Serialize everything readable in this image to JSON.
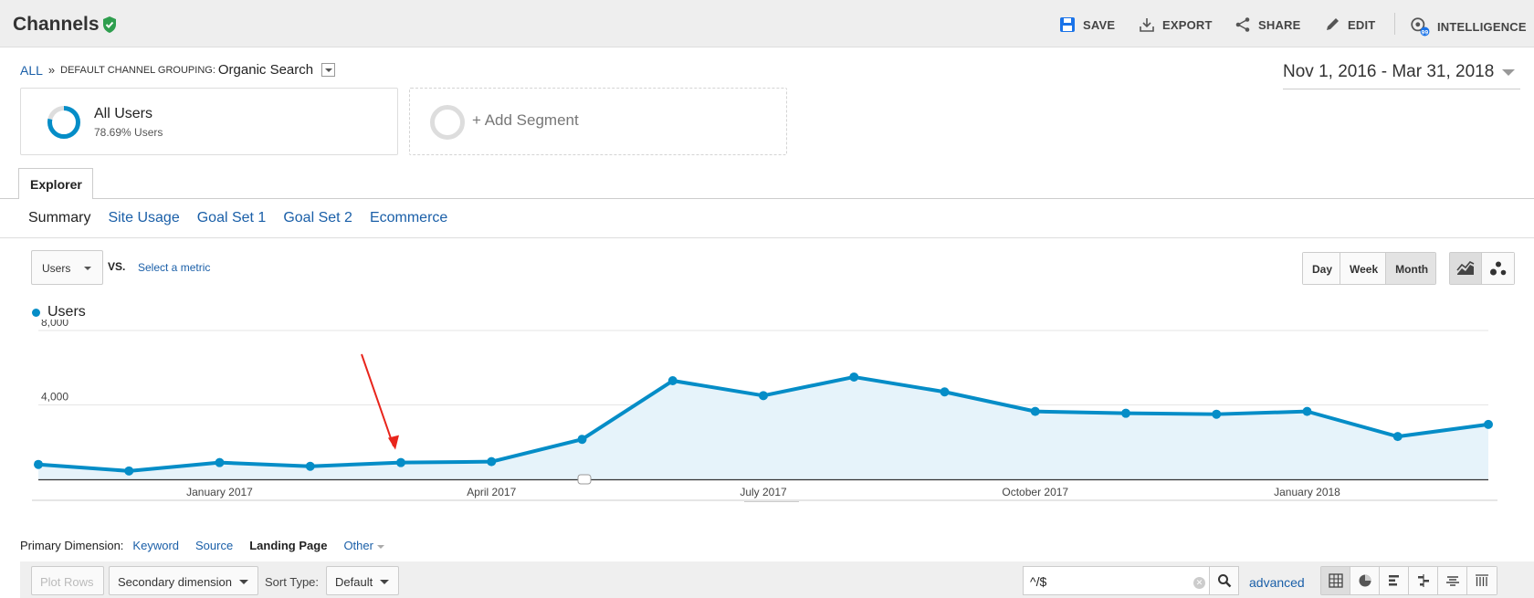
{
  "header": {
    "title": "Channels",
    "actions": {
      "save": "SAVE",
      "export": "EXPORT",
      "share": "SHARE",
      "edit": "EDIT",
      "intelligence": "INTELLIGENCE"
    }
  },
  "breadcrumb": {
    "all": "ALL",
    "sep": "»",
    "grouping_label": "DEFAULT CHANNEL GROUPING:",
    "grouping_value": "Organic Search"
  },
  "date_range": "Nov 1, 2016 - Mar 31, 2018",
  "segments": {
    "active": {
      "name": "All Users",
      "detail": "78.69% Users"
    },
    "add": "+ Add Segment"
  },
  "tabs": {
    "explorer": "Explorer"
  },
  "subtabs": [
    "Summary",
    "Site Usage",
    "Goal Set 1",
    "Goal Set 2",
    "Ecommerce"
  ],
  "controls": {
    "metric": "Users",
    "vs": "VS.",
    "select_metric": "Select a metric",
    "granularity": [
      "Day",
      "Week",
      "Month"
    ],
    "granularity_selected": "Month"
  },
  "primary_dimension": {
    "label": "Primary Dimension:",
    "options": [
      "Keyword",
      "Source",
      "Landing Page",
      "Other"
    ],
    "selected": "Landing Page"
  },
  "table_controls": {
    "plot_rows": "Plot Rows",
    "secondary_dimension": "Secondary dimension",
    "sort_type_label": "Sort Type:",
    "sort_type_value": "Default",
    "filter_value": "^/$",
    "advanced": "advanced"
  },
  "colors": {
    "series": "#058dc7",
    "area_fill": "#e6f3fa",
    "link": "#1a5fa8",
    "arrow": "#e8251c"
  },
  "chart_data": {
    "type": "area",
    "series": [
      {
        "name": "Users",
        "values": [
          800,
          450,
          900,
          700,
          900,
          950,
          2150,
          5300,
          4500,
          5500,
          4700,
          3650,
          3550,
          3500,
          3650,
          2300,
          2950
        ]
      }
    ],
    "x": [
      "Nov 2016",
      "Dec 2016",
      "Jan 2017",
      "Feb 2017",
      "Mar 2017",
      "Apr 2017",
      "May 2017",
      "Jun 2017",
      "Jul 2017",
      "Aug 2017",
      "Sep 2017",
      "Oct 2017",
      "Nov 2017",
      "Dec 2017",
      "Jan 2018",
      "Feb 2018",
      "Mar 2018"
    ],
    "x_tick_labels": [
      "January 2017",
      "April 2017",
      "July 2017",
      "October 2017",
      "January 2018"
    ],
    "y_tick_labels": [
      "8,000",
      "4,000"
    ],
    "ylim": [
      0,
      8000
    ],
    "legend": "top-left",
    "grid": true,
    "annotation": "red arrow pointing at Mar 2017"
  }
}
